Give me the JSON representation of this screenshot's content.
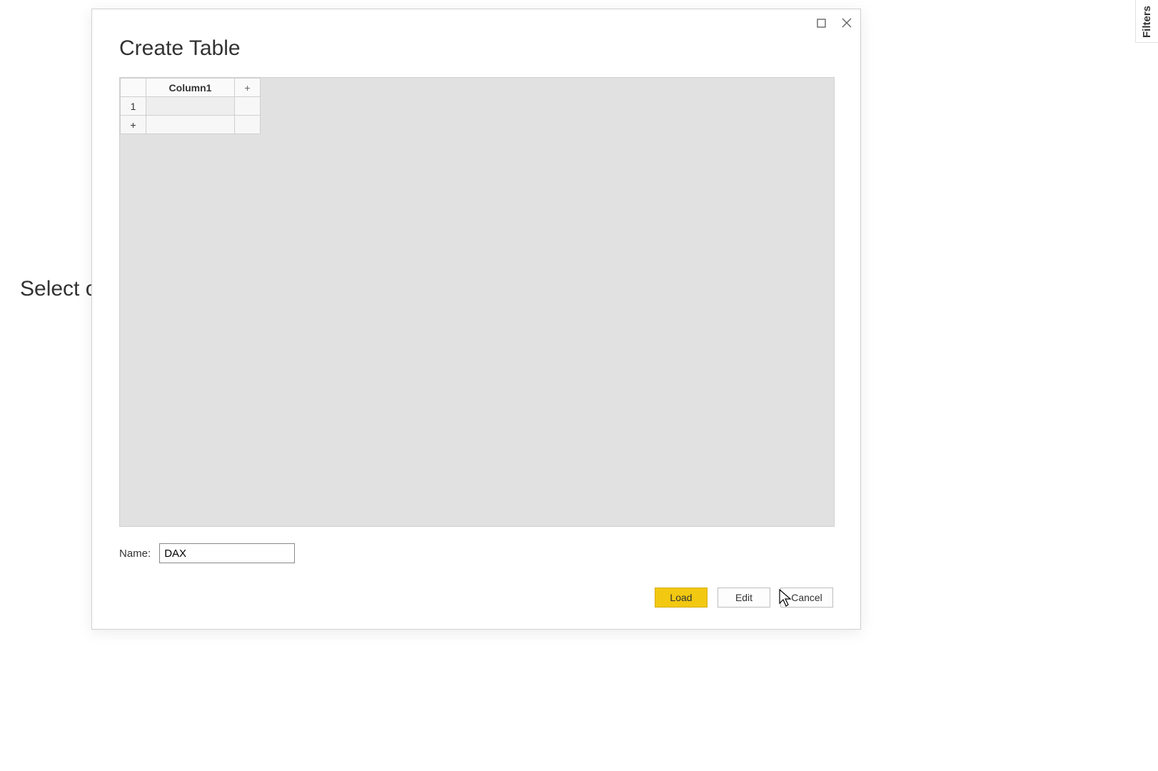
{
  "background": {
    "partial_text": "Select o"
  },
  "side_panel": {
    "filters_label": "Filters"
  },
  "dialog": {
    "title": "Create Table",
    "grid": {
      "column_header": "Column1",
      "add_col_symbol": "+",
      "row_index": "1",
      "add_row_symbol": "+"
    },
    "name_label": "Name:",
    "name_value": "DAX",
    "buttons": {
      "load": "Load",
      "edit": "Edit",
      "cancel": "Cancel"
    }
  }
}
